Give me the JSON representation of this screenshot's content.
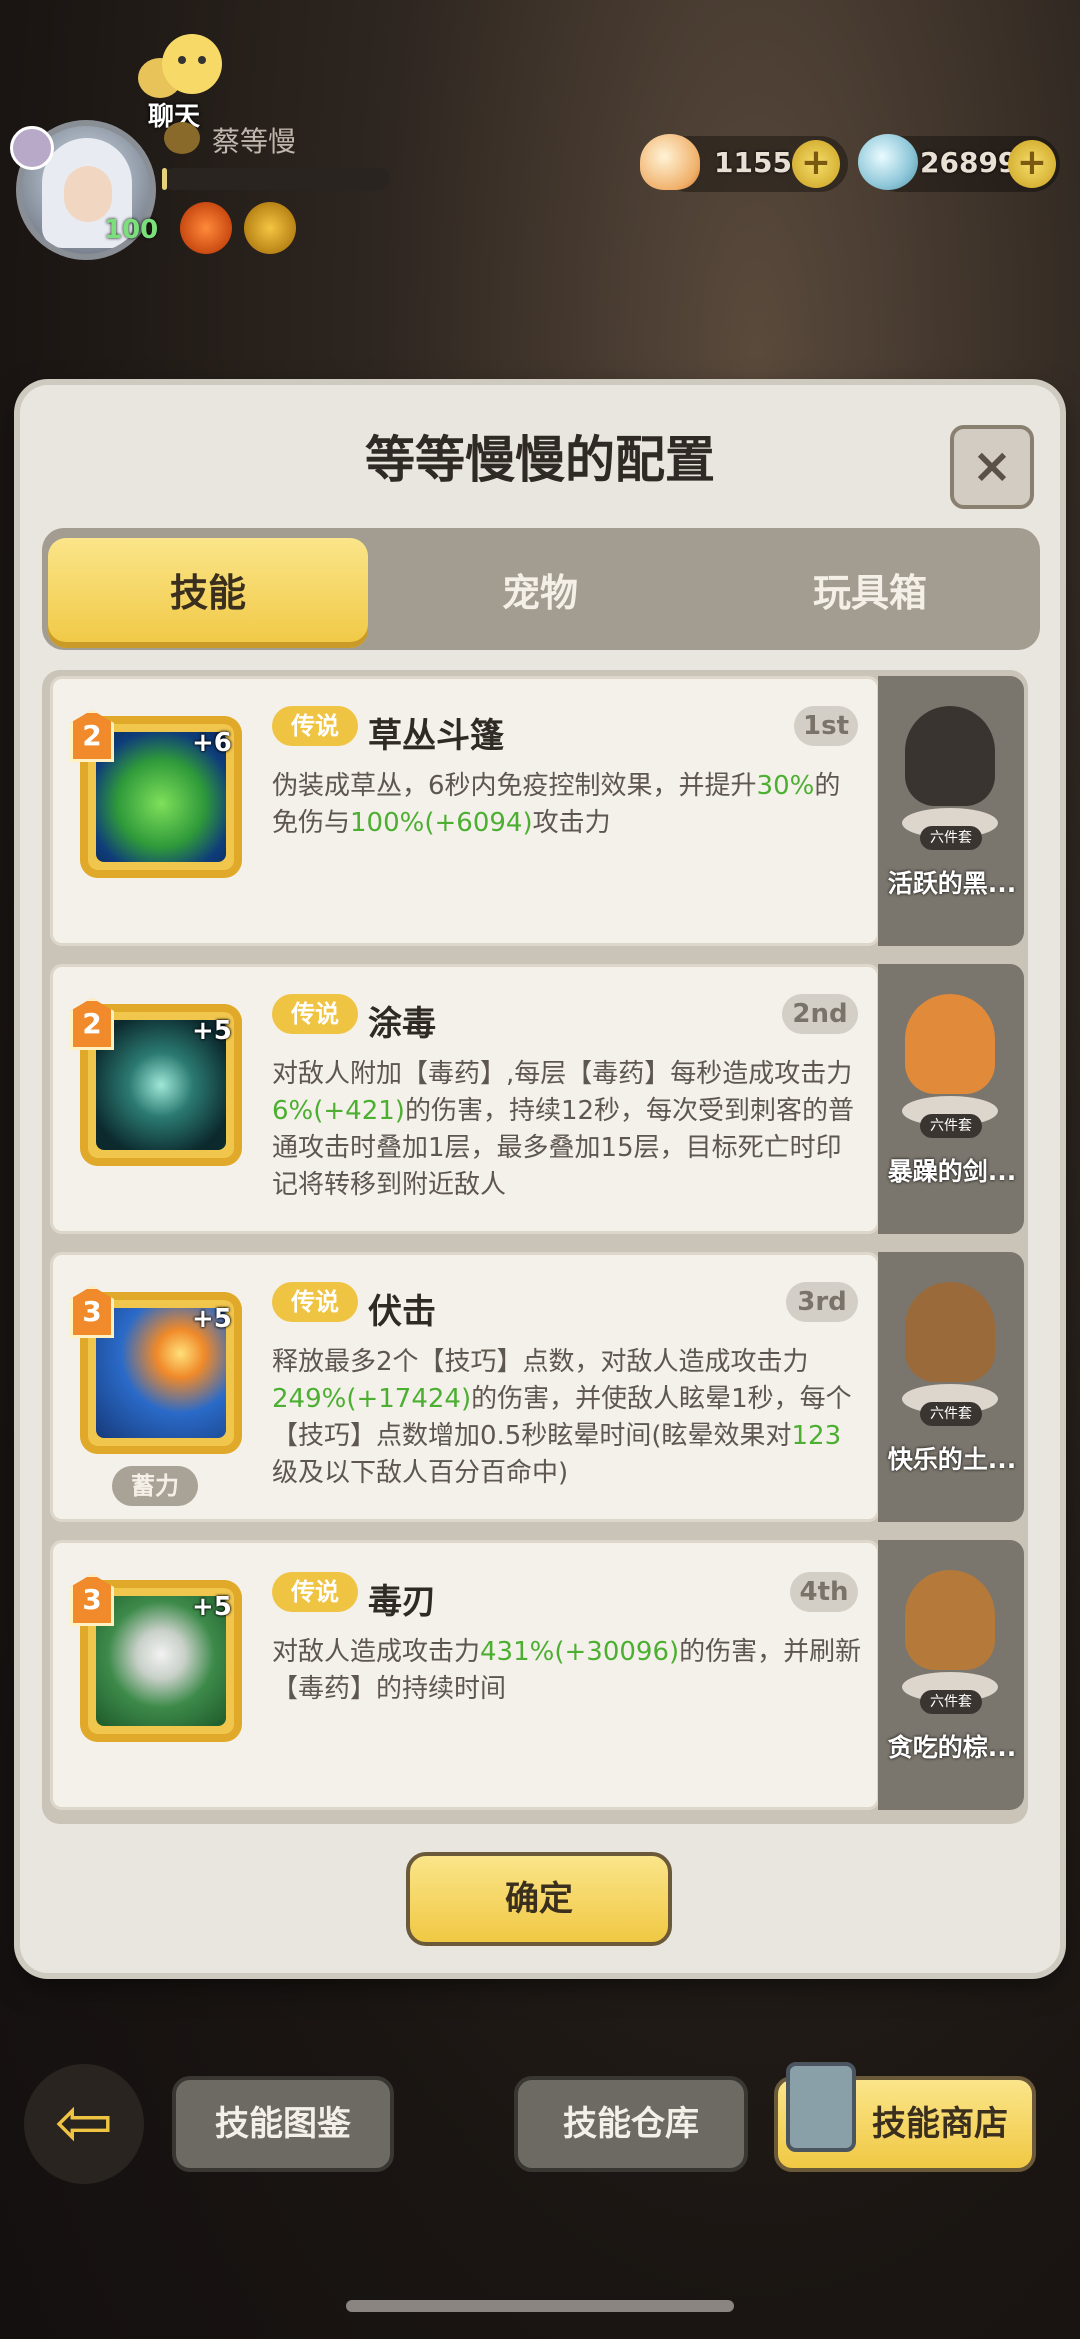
{
  "hud": {
    "chat_label": "聊天",
    "player_name": "蔡等慢",
    "level": "100",
    "xp_fraction": 0.02,
    "resources": [
      {
        "icon": "shell-icon",
        "value": "1155"
      },
      {
        "icon": "gem-icon",
        "value": "26899"
      }
    ],
    "plus_label": "+"
  },
  "dialog": {
    "title": "等等慢慢的配置",
    "close_label": "×",
    "tabs": [
      "技能",
      "宠物",
      "玩具箱"
    ],
    "active_tab": 0,
    "confirm_label": "确定"
  },
  "skills": [
    {
      "level": "2",
      "plus": "+6",
      "tag": "传说",
      "name": "草丛斗篷",
      "rank": "1st",
      "desc": [
        "伪装成草丛，6秒内免疫控制效果，并提升",
        "30%",
        "的免伤与",
        "100%(+6094)",
        "攻击力"
      ]
    },
    {
      "level": "2",
      "plus": "+5",
      "tag": "传说",
      "name": "涂毒",
      "rank": "2nd",
      "desc": [
        "对敌人附加【毒药】,每层【毒药】每秒造成攻击力",
        "6%(+421)",
        "的伤害，持续12秒，每次受到刺客的普通攻击时叠加1层，最多叠加15层，目标死亡时印记将转移到附近敌人"
      ]
    },
    {
      "level": "3",
      "plus": "+5",
      "tag": "传说",
      "name": "伏击",
      "rank": "3rd",
      "extra": "蓄力",
      "desc": [
        "释放最多2个【技巧】点数，对敌人造成攻击力",
        "249%(+17424)",
        "的伤害，并使敌人眩晕1秒，每个【技巧】点数增加0.5秒眩晕时间(眩晕效果对",
        "123",
        "级及以下敌人百分百命中)"
      ]
    },
    {
      "level": "3",
      "plus": "+5",
      "tag": "传说",
      "name": "毒刃",
      "rank": "4th",
      "desc": [
        "对敌人造成攻击力",
        "431%(+30096)",
        "的伤害，并刷新【毒药】的持续时间"
      ]
    }
  ],
  "pets": [
    {
      "tag": "六件套",
      "name": "活跃的黑..."
    },
    {
      "tag": "六件套",
      "name": "暴躁的剑..."
    },
    {
      "tag": "六件套",
      "name": "快乐的土..."
    },
    {
      "tag": "六件套",
      "name": "贪吃的棕..."
    }
  ],
  "bottom": {
    "back_icon": "back-arrow-icon",
    "buttons": [
      "技能图鉴",
      "技能仓库",
      "技能商店"
    ]
  }
}
